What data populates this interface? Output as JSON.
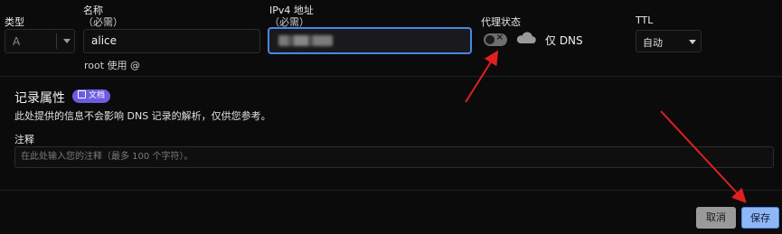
{
  "fields": {
    "type_label": "类型",
    "type_value": "A",
    "name_label": "名称",
    "name_required": "（必需）",
    "name_value": "alice",
    "name_hint": "root 使用 @",
    "ipv4_label": "IPv4 地址",
    "ipv4_required": "（必需）",
    "proxy_label": "代理状态",
    "proxy_text": "仅 DNS",
    "proxy_enabled": false,
    "ttl_label": "TTL",
    "ttl_value": "自动"
  },
  "record_attrs": {
    "title": "记录属性",
    "badge": "文档",
    "description": "此处提供的信息不会影响 DNS 记录的解析，仅供您参考。"
  },
  "comment": {
    "label": "注释",
    "placeholder": "在此处输入您的注释（最多 100 个字符）。"
  },
  "actions": {
    "cancel": "取消",
    "save": "保存"
  },
  "colors": {
    "focus_border": "#4a86e8",
    "badge_bg": "#6d5ce0",
    "annotation_arrow": "#e02020"
  }
}
